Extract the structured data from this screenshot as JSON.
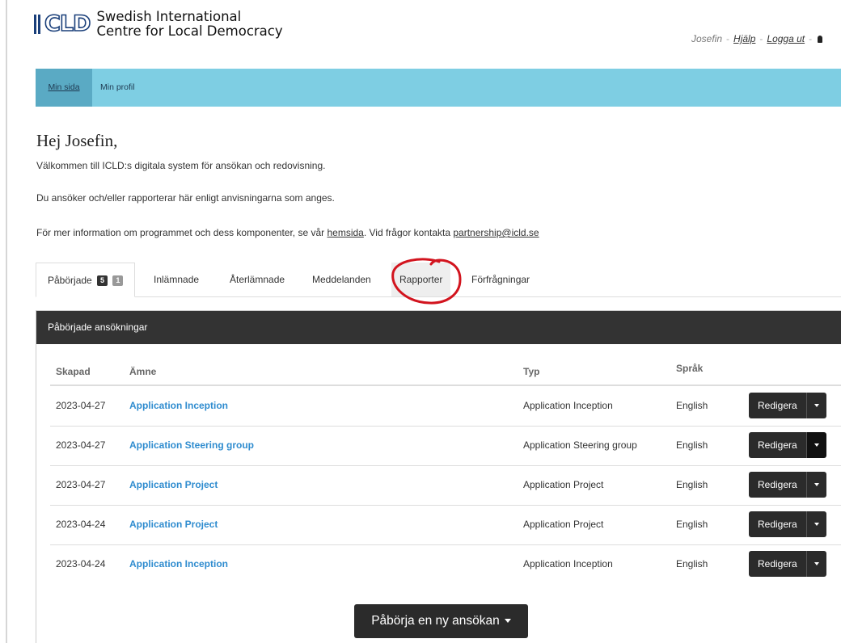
{
  "header": {
    "logo_letters": "CLD",
    "logo_line1": "Swedish International",
    "logo_line2": "Centre for Local Democracy",
    "user_name": "Josefin",
    "help_label": "Hjälp",
    "logout_label": "Logga ut"
  },
  "nav": {
    "items": [
      {
        "label": "Min sida",
        "active": true
      },
      {
        "label": "Min profil",
        "active": false
      }
    ],
    "bg_color": "#7ecee3",
    "active_bg_color": "#5aaac4"
  },
  "intro": {
    "greeting": "Hej Josefin,",
    "line1": "Välkommen till ICLD:s digitala system för ansökan och redovisning.",
    "line2": "Du ansöker och/eller rapporterar här enligt anvisningarna som anges.",
    "line3_prefix": "För mer information om programmet och dess komponenter, se vår ",
    "line3_link": "hemsida",
    "line3_middle": ". Vid frågor kontakta ",
    "line3_email": "partnership@icld.se"
  },
  "tabs": [
    {
      "label": "Påbörjade",
      "badges": [
        "5",
        "1"
      ],
      "active": true
    },
    {
      "label": "Inlämnade"
    },
    {
      "label": "Återlämnade"
    },
    {
      "label": "Meddelanden"
    },
    {
      "label": "Rapporter",
      "highlighted": true,
      "circled": true
    },
    {
      "label": "Förfrågningar"
    }
  ],
  "panel": {
    "title": "Påbörjade ansökningar",
    "columns": [
      "Skapad",
      "Ämne",
      "Typ",
      "Språk"
    ],
    "rows": [
      {
        "created": "2023-04-27",
        "subject": "Application Inception",
        "type": "Application Inception",
        "language": "English",
        "action": "Redigera"
      },
      {
        "created": "2023-04-27",
        "subject": "Application Steering group",
        "type": "Application Steering group",
        "language": "English",
        "action": "Redigera"
      },
      {
        "created": "2023-04-27",
        "subject": "Application Project",
        "type": "Application Project",
        "language": "English",
        "action": "Redigera"
      },
      {
        "created": "2023-04-24",
        "subject": "Application Project",
        "type": "Application Project",
        "language": "English",
        "action": "Redigera"
      },
      {
        "created": "2023-04-24",
        "subject": "Application Inception",
        "type": "Application Inception",
        "language": "English",
        "action": "Redigera"
      }
    ]
  },
  "new_application_label": "Påbörja en ny ansökan",
  "annotation_color": "#d2141e"
}
